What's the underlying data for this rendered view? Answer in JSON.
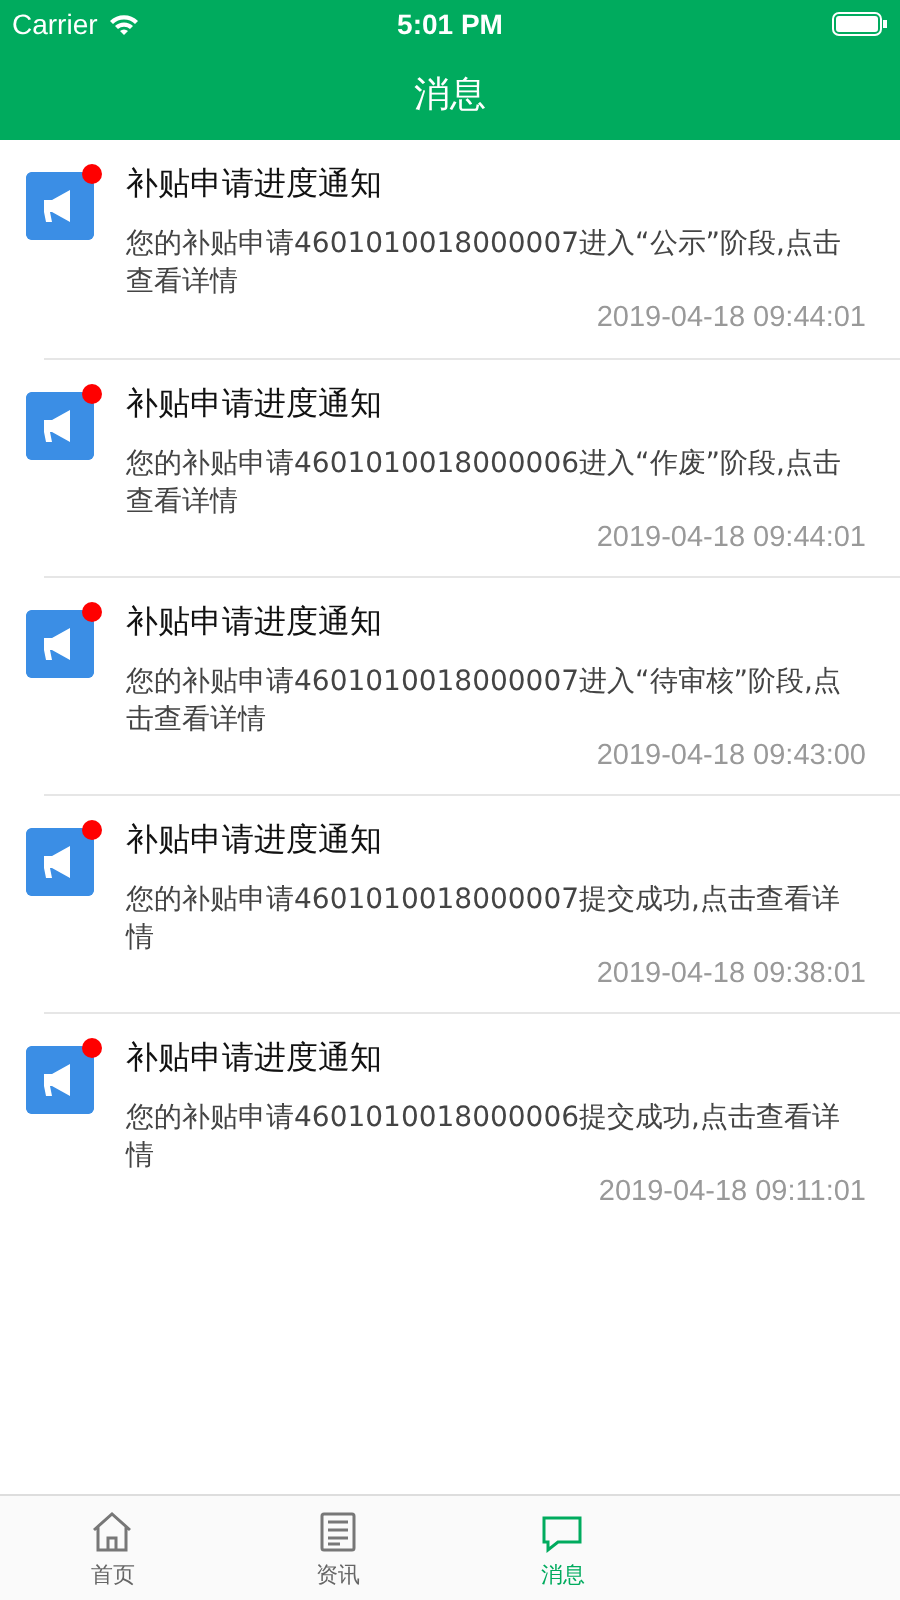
{
  "status_bar": {
    "carrier": "Carrier",
    "time": "5:01 PM"
  },
  "nav_bar": {
    "title": "消息"
  },
  "messages": [
    {
      "title": "补贴申请进度通知",
      "body": "您的补贴申请4601010018000007进入“公示”阶段,点击查看详情",
      "time": "2019-04-18 09:44:01",
      "unread": true
    },
    {
      "title": "补贴申请进度通知",
      "body": "您的补贴申请4601010018000006进入“作废”阶段,点击查看详情",
      "time": "2019-04-18 09:44:01",
      "unread": true
    },
    {
      "title": "补贴申请进度通知",
      "body": "您的补贴申请4601010018000007进入“待审核”阶段,点击查看详情",
      "time": "2019-04-18 09:43:00",
      "unread": true
    },
    {
      "title": "补贴申请进度通知",
      "body": "您的补贴申请4601010018000007提交成功,点击查看详情",
      "time": "2019-04-18 09:38:01",
      "unread": true
    },
    {
      "title": "补贴申请进度通知",
      "body": "您的补贴申请4601010018000006提交成功,点击查看详情",
      "time": "2019-04-18 09:11:01",
      "unread": true
    }
  ],
  "tab_bar": [
    {
      "kind": "home",
      "label": "首页",
      "selected": false
    },
    {
      "kind": "news",
      "label": "资讯",
      "selected": false
    },
    {
      "kind": "message",
      "label": "消息",
      "selected": true
    }
  ]
}
